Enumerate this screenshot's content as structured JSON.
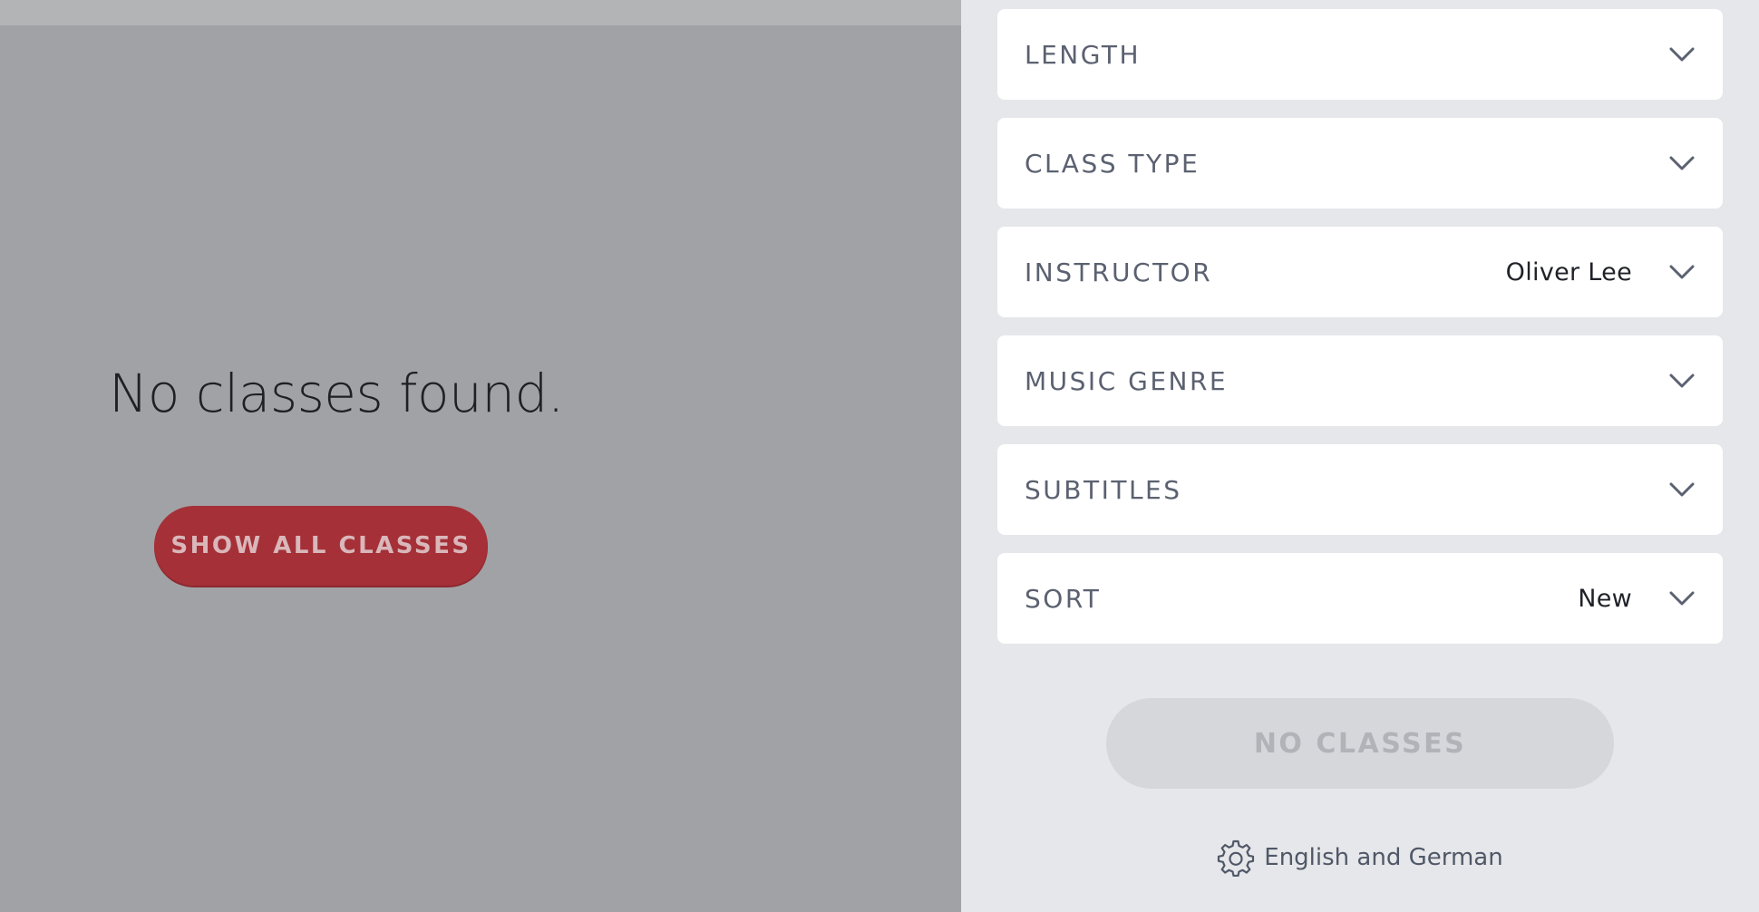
{
  "main": {
    "empty_message": "No classes found.",
    "show_all_label": "SHOW ALL CLASSES"
  },
  "filters": {
    "items": [
      {
        "label": "LENGTH",
        "value": ""
      },
      {
        "label": "CLASS TYPE",
        "value": ""
      },
      {
        "label": "INSTRUCTOR",
        "value": "Oliver Lee"
      },
      {
        "label": "MUSIC GENRE",
        "value": ""
      },
      {
        "label": "SUBTITLES",
        "value": ""
      },
      {
        "label": "SORT",
        "value": "New"
      }
    ],
    "submit_label": "NO CLASSES",
    "language_label": "English and German"
  },
  "icons": {
    "dropdown": "chevron-down-icon",
    "settings": "gear-icon"
  },
  "colors": {
    "accent": "#a53038",
    "panel_background": "#e6e7ea",
    "overlay": "#a1a2a5"
  }
}
